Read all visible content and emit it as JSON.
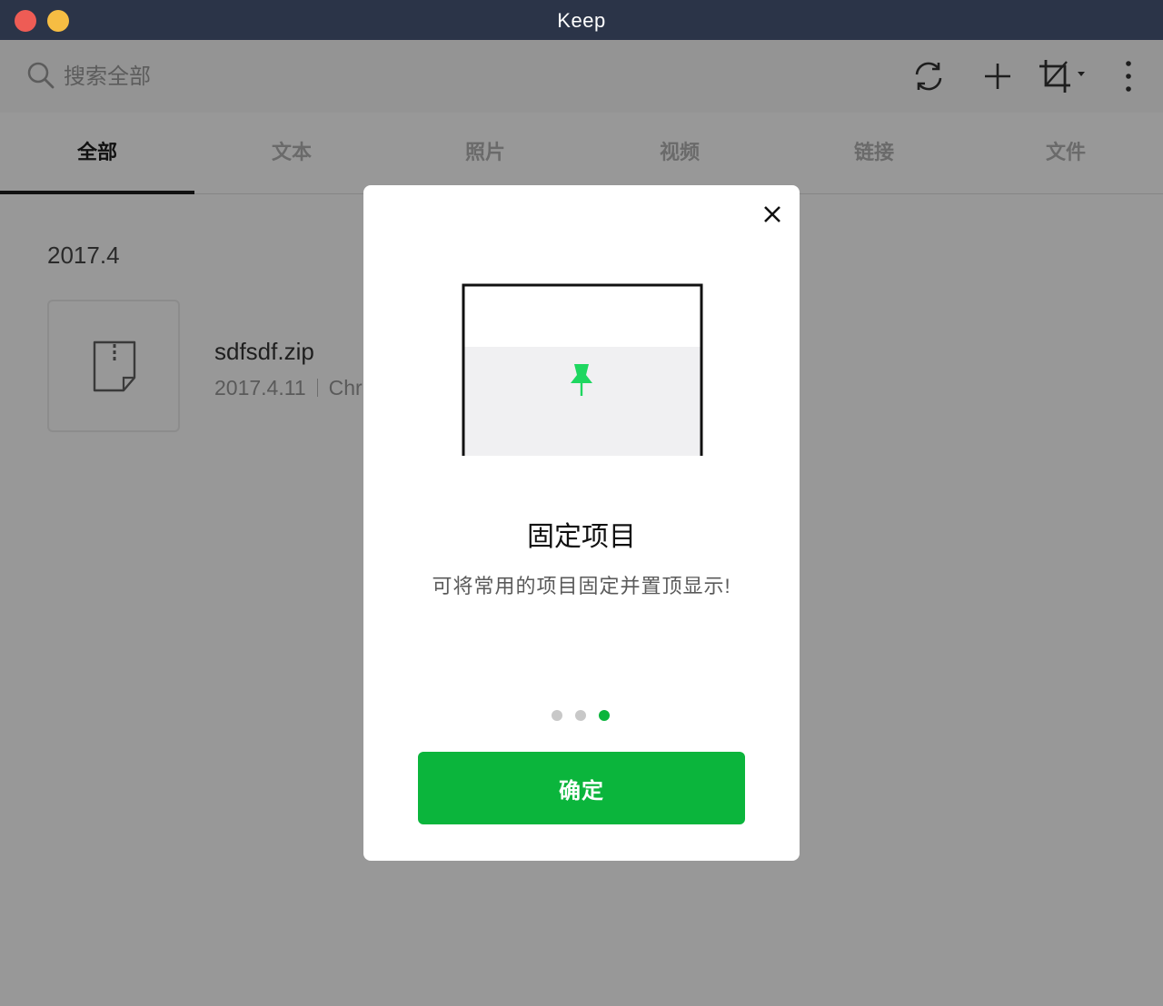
{
  "window": {
    "title": "Keep"
  },
  "search": {
    "placeholder": "搜索全部"
  },
  "toolbar": {
    "icons": [
      "refresh-icon",
      "add-icon",
      "crop-icon",
      "more-vertical-icon"
    ]
  },
  "tabs": [
    {
      "label": "全部",
      "active": true
    },
    {
      "label": "文本"
    },
    {
      "label": "照片"
    },
    {
      "label": "视频"
    },
    {
      "label": "链接"
    },
    {
      "label": "文件"
    }
  ],
  "content": {
    "section_date": "2017.4",
    "files": [
      {
        "name": "sdfsdf.zip",
        "date": "2017.4.11",
        "source": "Chr"
      }
    ]
  },
  "modal": {
    "title": "固定项目",
    "description": "可将常用的项目固定并置顶显示!",
    "pager": {
      "count": 3,
      "active_index": 2
    },
    "confirm_label": "确定"
  },
  "colors": {
    "titlebar": "#2b3448",
    "accent_green": "#0bb53c",
    "overlay_gray": "#989898"
  }
}
